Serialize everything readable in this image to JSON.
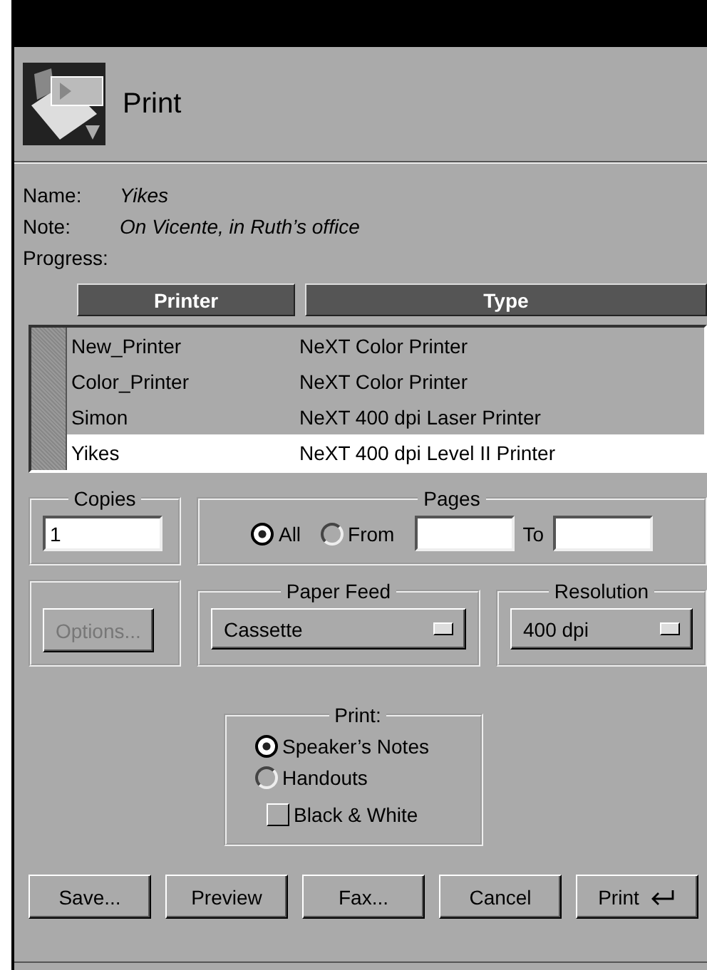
{
  "window": {
    "title": "Print"
  },
  "info": [
    {
      "label": "Name:",
      "value": "Yikes"
    },
    {
      "label": "Note:",
      "value": "On Vicente, in Ruth’s office"
    },
    {
      "label": "Progress:"
    }
  ],
  "printers": {
    "columns": [
      "Printer",
      "Type"
    ],
    "rows": [
      {
        "name": "New_Printer",
        "type": "NeXT Color Printer",
        "selected": false
      },
      {
        "name": "Color_Printer",
        "type": "NeXT Color Printer",
        "selected": false
      },
      {
        "name": "Simon",
        "type": "NeXT 400 dpi Laser Printer",
        "selected": false
      },
      {
        "name": "Yikes",
        "type": "NeXT 400 dpi Level II Printer",
        "selected": true
      }
    ]
  },
  "copies": {
    "title": "Copies",
    "value": "1"
  },
  "pages": {
    "title": "Pages",
    "options": [
      {
        "label": "All",
        "selected": true
      },
      {
        "label": "From",
        "selected": false
      }
    ],
    "to_label": "To"
  },
  "options_button": {
    "label": "Options...",
    "disabled": true
  },
  "paper_feed": {
    "title": "Paper Feed",
    "value": "Cassette"
  },
  "resolution": {
    "title": "Resolution",
    "value": "400 dpi"
  },
  "print_options": {
    "title": "Print:",
    "choices": [
      {
        "label": "Speaker’s Notes",
        "selected": true
      },
      {
        "label": "Handouts",
        "selected": false
      }
    ],
    "black_white": {
      "label": "Black & White",
      "checked": false
    }
  },
  "buttons": [
    {
      "label": "Save...",
      "kind": "plain"
    },
    {
      "label": "Preview",
      "kind": "plain"
    },
    {
      "label": "Fax...",
      "kind": "plain"
    },
    {
      "label": "Cancel",
      "kind": "plain"
    },
    {
      "label": "Print",
      "kind": "default"
    }
  ]
}
